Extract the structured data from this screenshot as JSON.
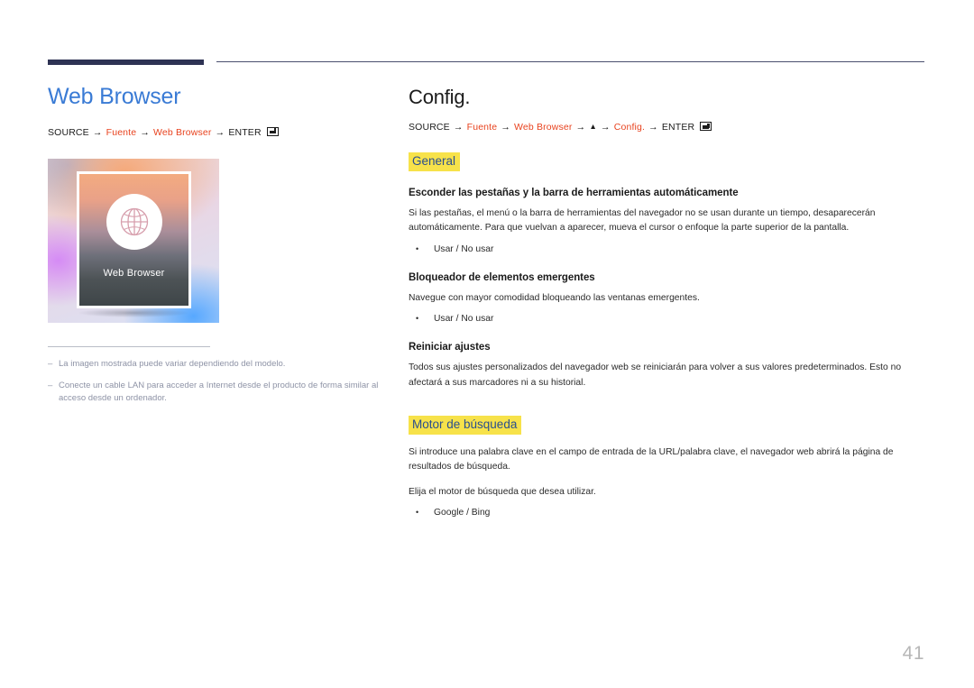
{
  "page": {
    "number": "41"
  },
  "left": {
    "title": "Web Browser",
    "path": {
      "start": "SOURCE",
      "item1": "Fuente",
      "item2": "Web Browser",
      "end": "ENTER",
      "arrow": "→"
    },
    "image": {
      "label": "Web Browser",
      "icon": "globe-icon"
    },
    "notes": [
      "La imagen mostrada puede variar dependiendo del modelo.",
      "Conecte un cable LAN para acceder a Internet desde el producto de forma similar al acceso desde un ordenador."
    ],
    "note_dash": "–"
  },
  "right": {
    "title": "Config.",
    "path": {
      "start": "SOURCE",
      "item1": "Fuente",
      "item2": "Web Browser",
      "up": "▲",
      "item3": "Config.",
      "end": "ENTER",
      "arrow": "→"
    },
    "sections": [
      {
        "tag": "General",
        "items": [
          {
            "heading": "Esconder las pestañas y la barra de herramientas automáticamente",
            "body": "Si las pestañas, el menú o la barra de herramientas del navegador no se usan durante un tiempo, desaparecerán automáticamente. Para que vuelvan a aparecer, mueva el cursor o enfoque la parte superior de la pantalla.",
            "bullet": "Usar / No usar"
          },
          {
            "heading": "Bloqueador de elementos emergentes",
            "body": "Navegue con mayor comodidad bloqueando las ventanas emergentes.",
            "bullet": "Usar / No usar"
          },
          {
            "heading": "Reiniciar ajustes",
            "body": "Todos sus ajustes personalizados del navegador web se reiniciarán para volver a sus valores predeterminados. Esto no afectará a sus marcadores ni a su historial.",
            "bullet": ""
          }
        ]
      },
      {
        "tag": "Motor de búsqueda",
        "body1": "Si introduce una palabra clave en el campo de entrada de la URL/palabra clave, el navegador web abrirá la página de resultados de búsqueda.",
        "body2": "Elija el motor de búsqueda que desea utilizar.",
        "bullet": "Google / Bing"
      }
    ]
  },
  "colors": {
    "accent_blue": "#3a7bd5",
    "path_highlight": "#e8431f",
    "tag_background": "#f7e24a",
    "tag_text": "#2b4f8e",
    "rule_dark": "#2e3354",
    "note_text": "#8e93a6"
  },
  "bullet_char": "•"
}
